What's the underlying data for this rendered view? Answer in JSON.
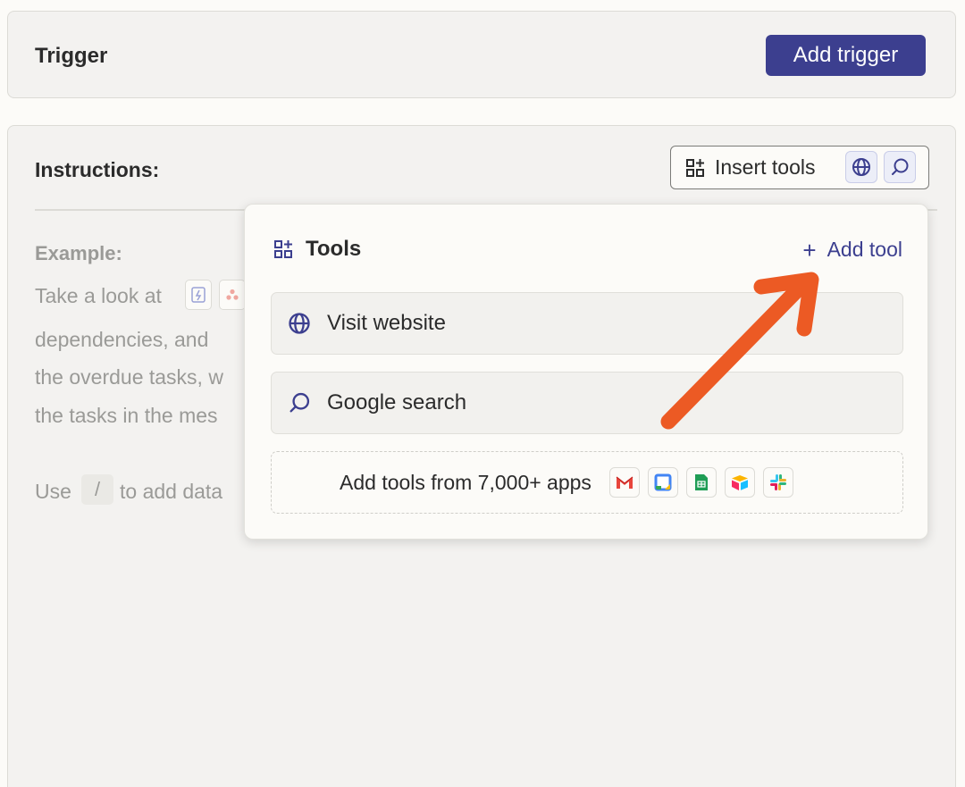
{
  "trigger": {
    "title": "Trigger",
    "add_button": "Add trigger"
  },
  "instructions": {
    "title": "Instructions:",
    "insert_tools_label": "Insert tools",
    "example_label": "Example:",
    "example_lines": [
      "Take a look at",
      "dependencies, and",
      "the overdue tasks, w",
      "the tasks in the mes"
    ],
    "use_prefix": "Use",
    "slash": "/",
    "use_suffix": "to add data"
  },
  "tools_popover": {
    "title": "Tools",
    "add_tool_plus": "+",
    "add_tool_label": "Add tool",
    "items": [
      {
        "label": "Visit website",
        "icon": "globe-icon"
      },
      {
        "label": "Google search",
        "icon": "search-icon"
      }
    ],
    "apps_text": "Add tools from 7,000+ apps",
    "app_icons": [
      "gmail-icon",
      "google-calendar-icon",
      "google-sheets-icon",
      "airtable-icon",
      "slack-icon"
    ]
  },
  "colors": {
    "accent": "#3c3f8f",
    "annotation_arrow": "#ec5a24",
    "card_bg": "#f3f2f0",
    "page_bg": "#fcfbf8"
  }
}
